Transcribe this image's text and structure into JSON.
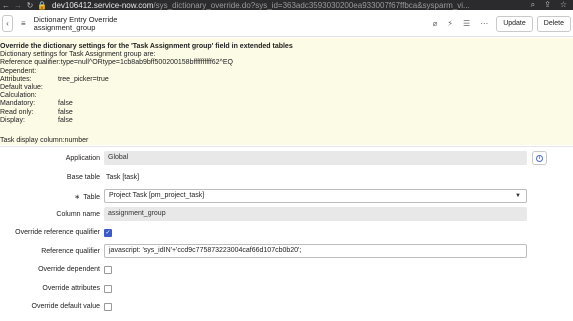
{
  "browser": {
    "host": "dev106412.service-now.com",
    "path": "/sys_dictionary_override.do?sys_id=363adc3593030200ea933007f67ffbca&sysparm_vi..."
  },
  "header": {
    "title": "Dictionary Entry Override",
    "subtitle": "assignment_group",
    "update_label": "Update",
    "delete_label": "Delete"
  },
  "info": {
    "heading": "Override the dictionary settings for the 'Task Assignment group' field in extended tables",
    "settings_line": "Dictionary settings for Task Assignment group are:",
    "ref_qual_line": "Reference qualifier:type=null^ORtype=1cb8ab9bff500200158bffffffffff62^EQ",
    "dependent_label": "Dependent:",
    "attributes_label": "Attributes:",
    "attributes_value": "tree_picker=true",
    "default_label": "Default value:",
    "calculation_label": "Calculation:",
    "mandatory_label": "Mandatory:",
    "mandatory_value": "false",
    "readonly_label": "Read only:",
    "readonly_value": "false",
    "display_label": "Display:",
    "display_value": "false",
    "task_display_column": "Task display column:number"
  },
  "form": {
    "application_label": "Application",
    "application_value": "Global",
    "base_table_label": "Base table",
    "base_table_value": "Task [task]",
    "table_label": "Table",
    "table_value": "Project Task [pm_project_task]",
    "column_name_label": "Column name",
    "column_name_value": "assignment_group",
    "override_ref_qual_label": "Override reference qualifier",
    "override_ref_qual_checked": true,
    "ref_qual_label": "Reference qualifier",
    "ref_qual_value": "javascript: 'sys_idIN'+'ccd9c775873223004caf66d107cb0b20';",
    "override_dependent_label": "Override dependent",
    "override_attributes_label": "Override attributes",
    "override_default_label": "Override default value"
  },
  "icons": [
    "back-icon",
    "forward-icon",
    "refresh-icon",
    "lock-icon",
    "menu-icon",
    "attachment-icon",
    "activity-icon",
    "settings-icon",
    "more-icon",
    "info-icon",
    "required-icon",
    "dropdown-icon",
    "checkmark-icon"
  ]
}
